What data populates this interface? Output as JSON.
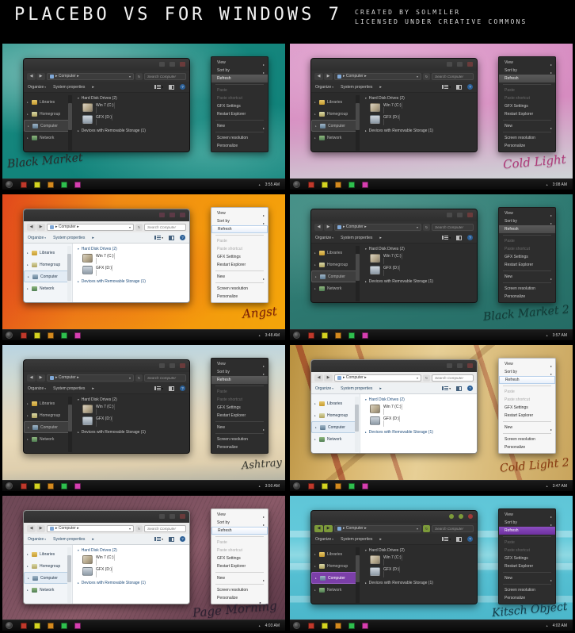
{
  "header": {
    "title": "PLACEBO VS FOR WINDOWS 7",
    "credit_line1": "CREATED BY SOLMILER",
    "credit_line2": "LICENSED UNDER CREATIVE COMMONS"
  },
  "explorer": {
    "window_buttons": [
      "minimize",
      "maximize",
      "close"
    ],
    "nav_back": "◀",
    "nav_forward": "▶",
    "address_path": "▸ Computer ▸",
    "address_caret": "▾",
    "refresh_glyph": "↻",
    "search_placeholder": "Search Computer",
    "command_organize": "Organize",
    "command_system_properties": "System properties",
    "command_caret": "▾",
    "command_more": "▸",
    "help_glyph": "?",
    "nav_items": [
      {
        "label": "Libraries",
        "icon": "library-icon"
      },
      {
        "label": "Homegroup",
        "icon": "homegroup-icon"
      },
      {
        "label": "Computer",
        "icon": "computer-icon"
      },
      {
        "label": "Network",
        "icon": "network-icon"
      }
    ],
    "selected_nav_item": "Computer",
    "group_hard_disk": "Hard Disk Drives (2)",
    "group_removable": "Devices with Removable Storage (1)",
    "group_expanded_glyph": "▾",
    "group_collapsed_glyph": "▸",
    "drives": [
      {
        "name": "Win 7 (C:)",
        "fill_percent": 18
      },
      {
        "name": "GFX (D:)",
        "fill_percent": 58
      }
    ]
  },
  "context_menu": {
    "items": [
      {
        "label": "View",
        "submenu": true,
        "disabled": false,
        "highlight": false
      },
      {
        "label": "Sort by",
        "submenu": true,
        "disabled": false,
        "highlight": false
      },
      {
        "label": "Refresh",
        "submenu": false,
        "disabled": false,
        "highlight": true
      },
      {
        "separator": true
      },
      {
        "label": "Paste",
        "submenu": false,
        "disabled": true,
        "highlight": false
      },
      {
        "label": "Paste shortcut",
        "submenu": false,
        "disabled": true,
        "highlight": false
      },
      {
        "label": "GFX Settings",
        "submenu": false,
        "disabled": false,
        "highlight": false
      },
      {
        "label": "Restart Explorer",
        "submenu": false,
        "disabled": false,
        "highlight": false
      },
      {
        "separator": true
      },
      {
        "label": "New",
        "submenu": true,
        "disabled": false,
        "highlight": false
      },
      {
        "separator": true
      },
      {
        "label": "Screen resolution",
        "submenu": false,
        "disabled": false,
        "highlight": false
      },
      {
        "label": "Personalize",
        "submenu": false,
        "disabled": false,
        "highlight": false
      }
    ],
    "submenu_arrow": "▸"
  },
  "taskbar": {
    "start_orb": "start-orb",
    "tray_caret": "▴",
    "pinned_colors": [
      "#c0392b",
      "#d4d321",
      "#d48a1f",
      "#2fbf4e",
      "#d63fb0"
    ]
  },
  "panels": [
    {
      "id": 1,
      "theme_name": "Black Market",
      "clock": "3:55 AM",
      "window_style": "dark",
      "wallpaper": "teal-clouds",
      "sig_color": "#2a2a2a"
    },
    {
      "id": 2,
      "theme_name": "Cold Light",
      "clock": "3:08 AM",
      "window_style": "dark",
      "wallpaper": "pink-gradient",
      "sig_color": "#b03a7a"
    },
    {
      "id": 3,
      "theme_name": "Angst",
      "clock": "3:48 AM",
      "window_style": "light",
      "wallpaper": "orange-gradient",
      "sig_color": "#7a1d08"
    },
    {
      "id": 4,
      "theme_name": "Black Market 2",
      "clock": "3:57 AM",
      "window_style": "dark",
      "wallpaper": "dark-teal",
      "sig_color": "#123a36"
    },
    {
      "id": 5,
      "theme_name": "Ashtray",
      "clock": "3:50 AM",
      "window_style": "dark",
      "wallpaper": "sky-beige",
      "sig_color": "#3a3a32"
    },
    {
      "id": 6,
      "theme_name": "Cold Light 2",
      "clock": "3:47 AM",
      "window_style": "light",
      "wallpaper": "wood-ochre",
      "sig_color": "#8a3a10"
    },
    {
      "id": 7,
      "theme_name": "Page Morning",
      "clock": "4:03 AM",
      "window_style": "light",
      "wallpaper": "mauve-stripes",
      "sig_color": "#2b2030"
    },
    {
      "id": 8,
      "theme_name": "Kitsch Object",
      "clock": "4:02 AM",
      "window_style": "dark-purple",
      "wallpaper": "cyan-stripes",
      "sig_color": "#143c4a"
    }
  ]
}
